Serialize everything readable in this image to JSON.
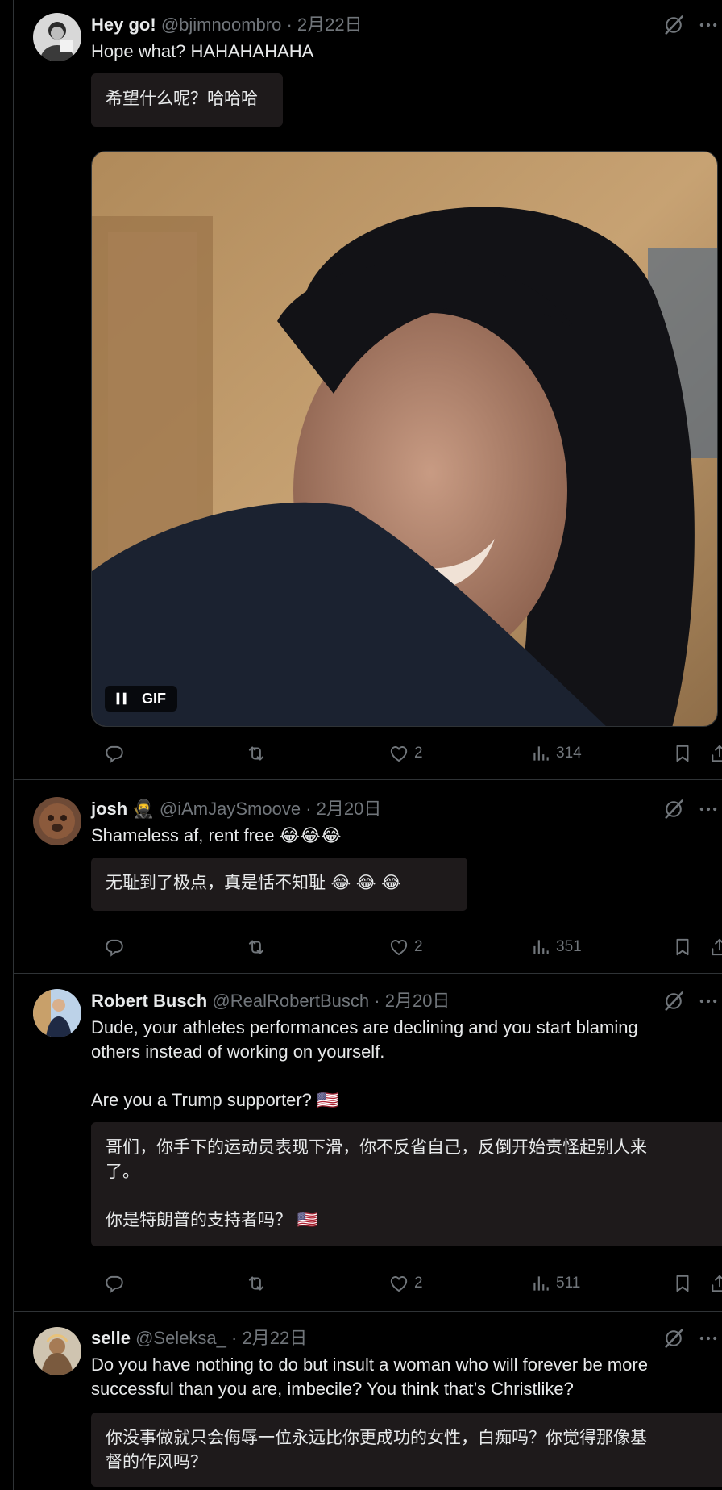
{
  "replies": [
    {
      "name": "Hey go!",
      "handle": "@bjimnoombro",
      "separator": "·",
      "date": "2月22日",
      "text": "Hope what? HAHAHAHAHA",
      "translation": "希望什么呢？哈哈哈",
      "media": {
        "badge": "GIF"
      },
      "actions": {
        "reply": "",
        "repost": "",
        "likes": "2",
        "views": "314"
      }
    },
    {
      "name": "josh",
      "name_emoji": "🥷",
      "handle": "@iAmJaySmoove",
      "separator": "·",
      "date": "2月20日",
      "text": "Shameless af, rent free 😂😂😂",
      "translation": "无耻到了极点，真是恬不知耻 😂 😂 😂",
      "actions": {
        "reply": "",
        "repost": "",
        "likes": "2",
        "views": "351"
      }
    },
    {
      "name": "Robert Busch",
      "handle": "@RealRobertBusch",
      "separator": "·",
      "date": "2月20日",
      "text": "Dude, your athletes performances are declining and you start blaming\nothers instead of working on yourself.\n\nAre you a Trump supporter? 🇺🇸",
      "translation": "哥们，你手下的运动员表现下滑，你不反省自己，反倒开始责怪起别人来\n了。\n\n你是特朗普的支持者吗？ 🇺🇸",
      "actions": {
        "reply": "",
        "repost": "",
        "likes": "2",
        "views": "511"
      }
    },
    {
      "name": "selle",
      "handle": "@Seleksa_",
      "separator": "·",
      "date": "2月22日",
      "text": "Do you have nothing to do but insult a woman who will forever be more\nsuccessful than you are, imbecile? You think that’s Christlike?",
      "translation": "你没事做就只会侮辱一位永远比你更成功的女性，白痴吗？你觉得那像基\n督的作风吗？"
    }
  ],
  "icons": {
    "reply": "reply-icon",
    "repost": "repost-icon",
    "like": "heart-icon",
    "views": "views-icon",
    "bookmark": "bookmark-icon",
    "share": "share-icon",
    "grok": "grok-icon",
    "more": "more-icon"
  },
  "colors": {
    "background": "#000000",
    "text": "#e7e9ea",
    "muted": "#71767b",
    "translation_bg": "#1e1a1b",
    "divider": "#2f3336"
  }
}
